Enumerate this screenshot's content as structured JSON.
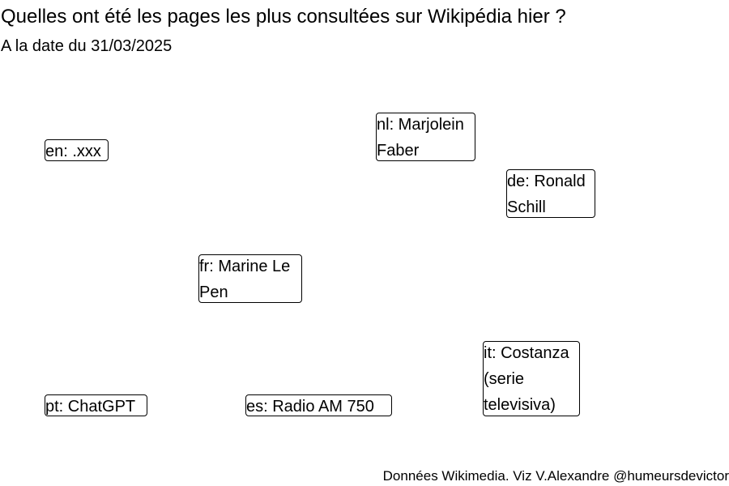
{
  "title": "Quelles ont été les pages les plus consultées sur Wikipédia hier ?",
  "subtitle": "A la date du 31/03/2025",
  "caption": "Données Wikimedia. Viz V.Alexandre @humeursdevictor",
  "labels": [
    {
      "id": "en",
      "lines": [
        "en: .xxx"
      ]
    },
    {
      "id": "nl",
      "lines": [
        "nl: Marjolein",
        "Faber"
      ]
    },
    {
      "id": "de",
      "lines": [
        "de: Ronald",
        "Schill"
      ]
    },
    {
      "id": "fr",
      "lines": [
        "fr: Marine Le",
        "Pen"
      ]
    },
    {
      "id": "it",
      "lines": [
        "it: Costanza",
        "(serie",
        "televisiva)"
      ]
    },
    {
      "id": "pt",
      "lines": [
        "pt: ChatGPT"
      ]
    },
    {
      "id": "es",
      "lines": [
        "es: Radio AM 750"
      ]
    }
  ]
}
